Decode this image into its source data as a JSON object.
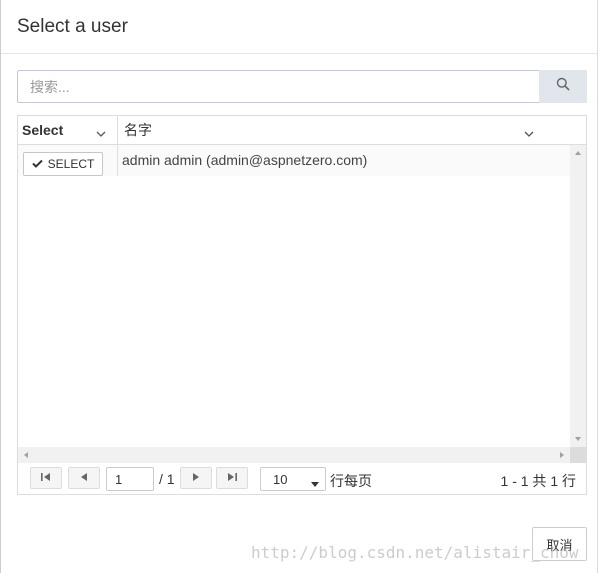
{
  "modal": {
    "title": "Select a user"
  },
  "search": {
    "placeholder": "搜索...",
    "value": "",
    "icon": "search-icon"
  },
  "grid": {
    "columns": [
      {
        "label": "Select"
      },
      {
        "label": "名字"
      }
    ],
    "rows": [
      {
        "select_label": "SELECT",
        "name": "admin admin (admin@aspnetzero.com)"
      }
    ]
  },
  "pager": {
    "current_page": "1",
    "total_pages": "/ 1",
    "page_size": "10",
    "per_page_label": "行每页",
    "range_info": "1 - 1 共 1 行"
  },
  "footer": {
    "cancel_label": "取消"
  },
  "watermark": "http://blog.csdn.net/alistair_chow",
  "colors": {
    "search_button_bg": "#e1e5ec",
    "row_bg": "#fafafa",
    "border": "#dddddd"
  }
}
